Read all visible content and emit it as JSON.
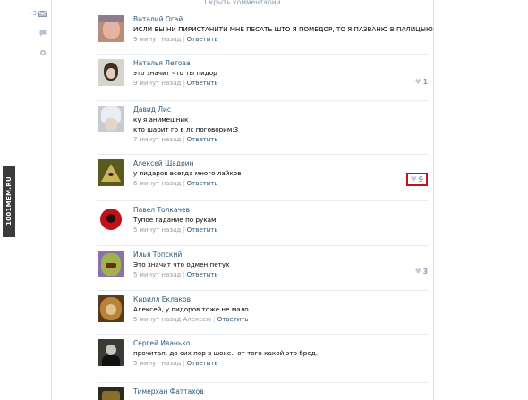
{
  "top": {
    "hide_comments": "Скрыть комментарии"
  },
  "left_rail": {
    "messages_count": "+3",
    "icons": [
      "mail-icon",
      "chat-icon",
      "settings-icon"
    ]
  },
  "watermark": "1001MEM.RU",
  "comments": [
    {
      "author": "Виталий Огай",
      "lines": [
        "ИСЛИ ВЫ НИ ПИРИСТАНИТИ МНЕ ПЕСАТЬ ШТО Я ПОМЕДОР, ТО Я ПАЗВАНЮ В ПАЛИЦЫЮ"
      ],
      "time": "9 минут назад",
      "reply": "Ответить",
      "likes": ""
    },
    {
      "author": "Наталья Летова",
      "lines": [
        "это значит что ты пидор"
      ],
      "time": "9 минут назад",
      "reply": "Ответить",
      "likes": "1"
    },
    {
      "author": "Давид Лис",
      "lines": [
        "ку я анимешник",
        "кто шарит го в лс поговорим:3"
      ],
      "time": "7 минут назад",
      "reply": "Ответить",
      "likes": ""
    },
    {
      "author": "Алексей Щадрин",
      "lines": [
        "у пидаров всегда много лайков"
      ],
      "time": "6 минут назад",
      "reply": "Ответить",
      "likes": "9",
      "highlight": true
    },
    {
      "author": "Павел Толкачев",
      "lines": [
        "Тупое гадание по рукам"
      ],
      "time": "5 минут назад",
      "reply": "Ответить",
      "likes": ""
    },
    {
      "author": "Илья Топский",
      "lines": [
        "Это значит что одмен петух"
      ],
      "time": "5 минут назад",
      "reply": "Ответить",
      "likes": "3"
    },
    {
      "author": "Кирилл Еклаков",
      "lines": [
        "Алексей, у пидоров тоже не мало"
      ],
      "time": "5 минут назад Алексею",
      "reply": "Ответить",
      "likes": ""
    },
    {
      "author": "Сергей Иванько",
      "lines": [
        "прочитал, до сих пор в шоке.. от того какой это бред."
      ],
      "time": "5 минут назад",
      "reply": "Ответить",
      "likes": ""
    },
    {
      "author": "Тимерхан Фаттахов",
      "lines": [],
      "time": "",
      "reply": "",
      "likes": ""
    }
  ],
  "colors": {
    "link": "#2b587a",
    "muted": "#999999",
    "like_highlight": "#c0161b"
  }
}
